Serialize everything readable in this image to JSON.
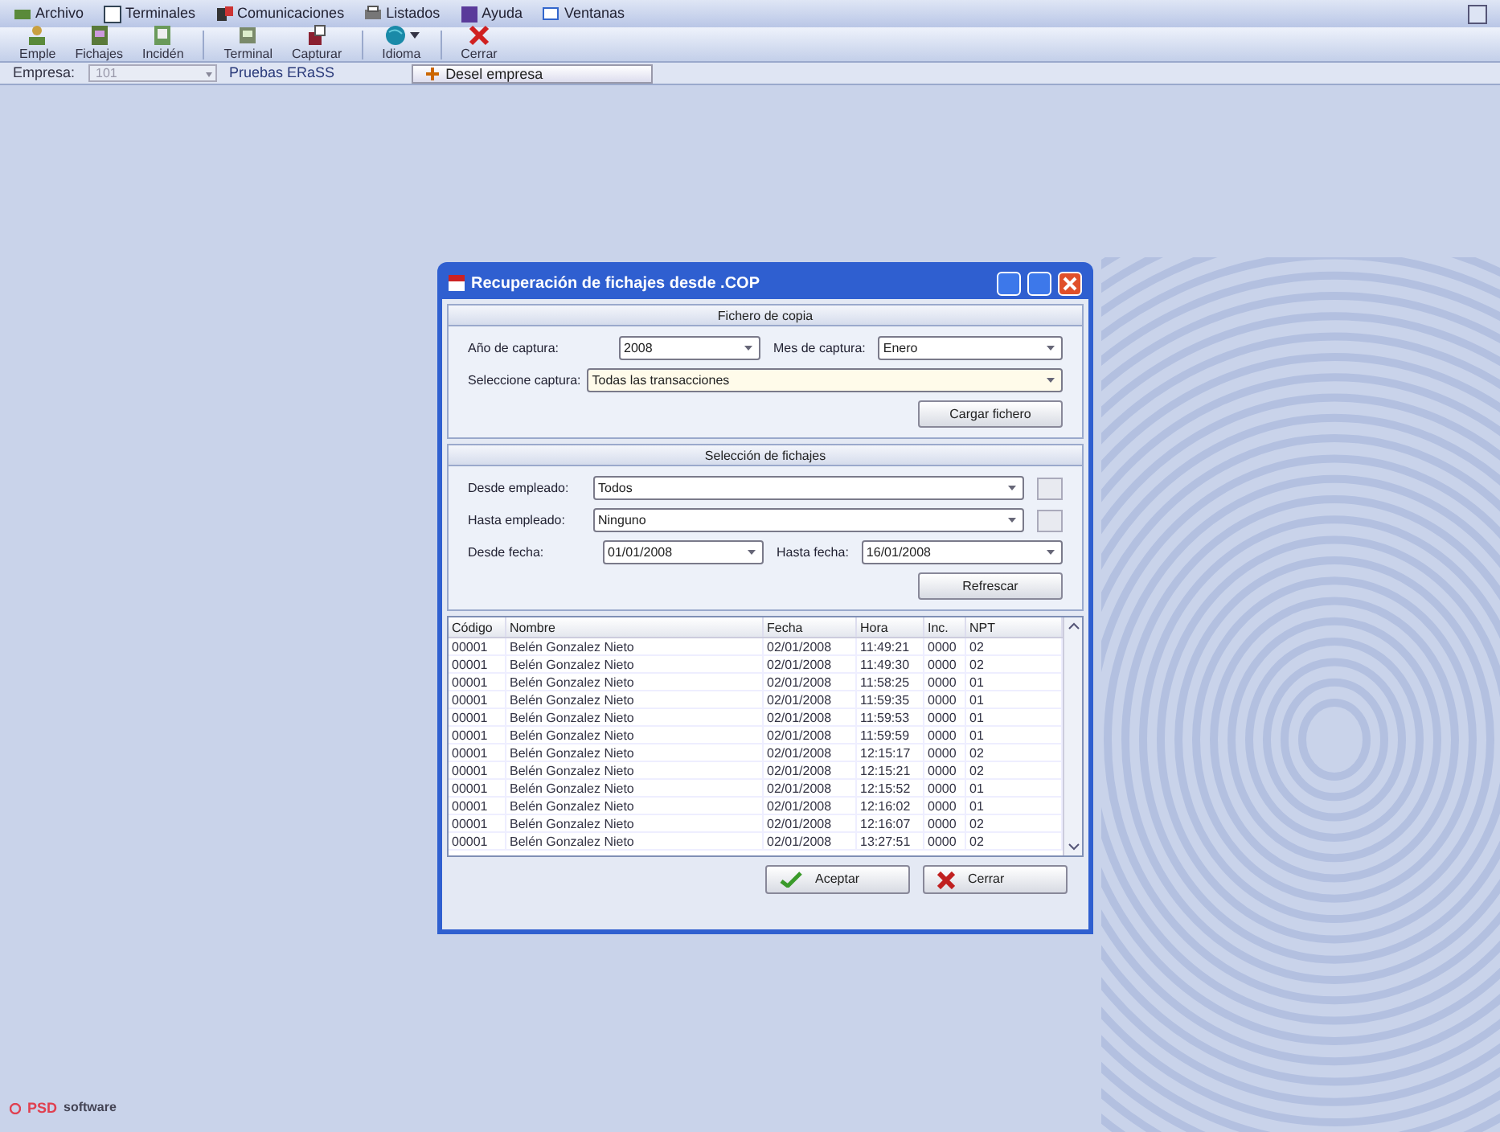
{
  "menu": [
    "Archivo",
    "Terminales",
    "Comunicaciones",
    "Listados",
    "Ayuda",
    "Ventanas"
  ],
  "toolbar": [
    "Emple",
    "Fichajes",
    "Incidén",
    "Terminal",
    "Capturar",
    "Idioma",
    "Cerrar"
  ],
  "company_bar": {
    "label": "Empresa:",
    "value": "101",
    "name": "Pruebas ERaSS",
    "button": "Desel empresa"
  },
  "dialog": {
    "title": "Recuperación de fichajes desde .COP",
    "capture_section": {
      "title": "Fichero de copia",
      "year_label": "Año de captura:",
      "year": "2008",
      "month_label": "Mes de captura:",
      "month": "Enero",
      "select_label": "Seleccione captura:",
      "select": "Todas las transacciones",
      "button": "Cargar fichero"
    },
    "selection_section": {
      "title": "Selección de fichajes",
      "from_emp_label": "Desde empleado:",
      "from_emp": "Todos",
      "to_emp_label": "Hasta empleado:",
      "to_emp": "Ninguno",
      "from_date_label": "Desde fecha:",
      "from_date": "01/01/2008",
      "to_date_label": "Hasta fecha:",
      "to_date": "16/01/2008",
      "button": "Refrescar"
    },
    "table": {
      "columns": [
        "Código",
        "Nombre",
        "Fecha",
        "Hora",
        "Inc.",
        "NPT"
      ],
      "rows": [
        [
          "00001",
          "Belén Gonzalez Nieto",
          "02/01/2008",
          "11:49:21",
          "0000",
          "02"
        ],
        [
          "00001",
          "Belén Gonzalez Nieto",
          "02/01/2008",
          "11:49:30",
          "0000",
          "02"
        ],
        [
          "00001",
          "Belén Gonzalez Nieto",
          "02/01/2008",
          "11:58:25",
          "0000",
          "01"
        ],
        [
          "00001",
          "Belén Gonzalez Nieto",
          "02/01/2008",
          "11:59:35",
          "0000",
          "01"
        ],
        [
          "00001",
          "Belén Gonzalez Nieto",
          "02/01/2008",
          "11:59:53",
          "0000",
          "01"
        ],
        [
          "00001",
          "Belén Gonzalez Nieto",
          "02/01/2008",
          "11:59:59",
          "0000",
          "01"
        ],
        [
          "00001",
          "Belén Gonzalez Nieto",
          "02/01/2008",
          "12:15:17",
          "0000",
          "02"
        ],
        [
          "00001",
          "Belén Gonzalez Nieto",
          "02/01/2008",
          "12:15:21",
          "0000",
          "02"
        ],
        [
          "00001",
          "Belén Gonzalez Nieto",
          "02/01/2008",
          "12:15:52",
          "0000",
          "01"
        ],
        [
          "00001",
          "Belén Gonzalez Nieto",
          "02/01/2008",
          "12:16:02",
          "0000",
          "01"
        ],
        [
          "00001",
          "Belén Gonzalez Nieto",
          "02/01/2008",
          "12:16:07",
          "0000",
          "02"
        ],
        [
          "00001",
          "Belén Gonzalez Nieto",
          "02/01/2008",
          "13:27:51",
          "0000",
          "02"
        ]
      ]
    },
    "buttons": [
      {
        "label": "Aceptar",
        "kind": "ok"
      },
      {
        "label": "Cerrar",
        "kind": "cancel"
      }
    ]
  },
  "footer": {
    "logo": "PSD",
    "text": "software"
  }
}
